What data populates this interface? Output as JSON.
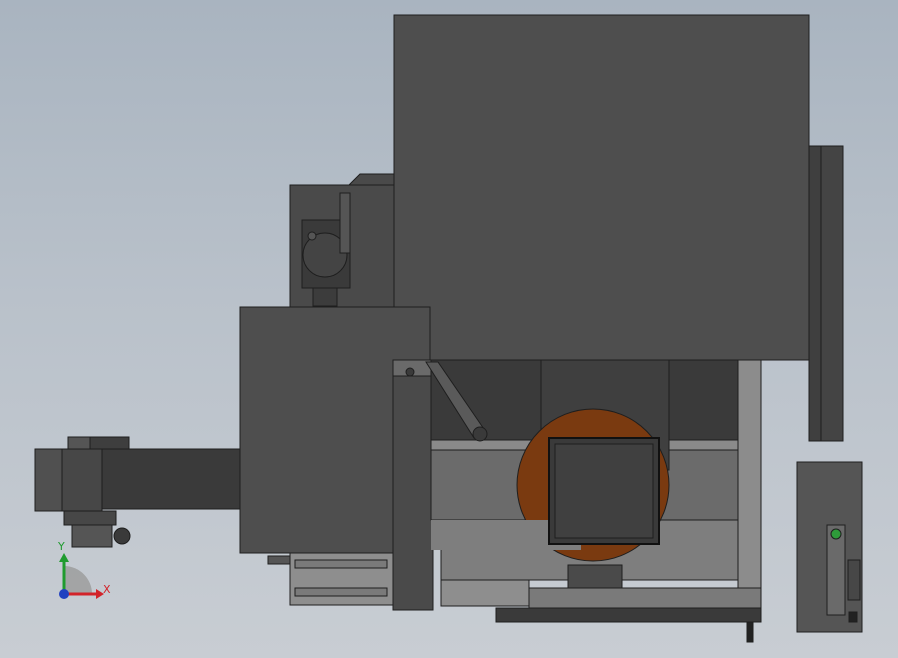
{
  "viewport": {
    "background_top": "#a9b4c0",
    "background_bottom": "#c8cdd3"
  },
  "model": {
    "body_color": "#4d4d4d",
    "dark_color": "#3a3a3a",
    "panel_color": "#565656",
    "light_panel_color": "#8e8e8e",
    "edge_color": "#1e1e1e",
    "rotary_table_color": "#7a3a10",
    "indicator_color": "#2e9b3a"
  },
  "triad": {
    "x_label": "X",
    "y_label": "Y",
    "x_color": "#d2232a",
    "y_color": "#1f9b2e",
    "z_color": "#2040c0"
  }
}
